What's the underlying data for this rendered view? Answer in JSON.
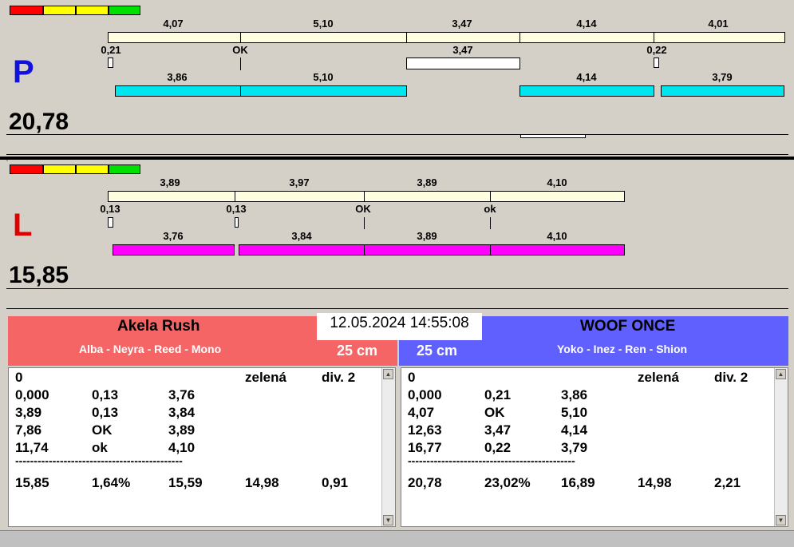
{
  "lanes": {
    "p": {
      "letter": "P",
      "letter_color": "#1010e0",
      "total": "20,78",
      "top_labels": [
        "4,07",
        "5,10",
        "3,47",
        "4,14",
        "4,01"
      ],
      "mid_labels": [
        "0,21",
        "OK",
        "3,47",
        "0,22"
      ],
      "bottom_labels": [
        "3,86",
        "5,10",
        "4,14",
        "3,79"
      ],
      "bar_color": "#00e5ee"
    },
    "l": {
      "letter": "L",
      "letter_color": "#e00000",
      "total": "15,85",
      "top_labels": [
        "3,89",
        "3,97",
        "3,89",
        "4,10"
      ],
      "mid_labels": [
        "0,13",
        "0,13",
        "OK",
        "ok"
      ],
      "bottom_labels": [
        "3,76",
        "3,84",
        "3,89",
        "4,10"
      ],
      "bar_color": "#ff00ff"
    }
  },
  "signal_colors": [
    "#ff0000",
    "#ffff00",
    "#ffff00",
    "#00e000"
  ],
  "datetime": "12.05.2024 14:55:08",
  "team_left": {
    "name": "Akela Rush",
    "dogs": "Alba - Neyra - Reed - Mono",
    "cm": "25 cm",
    "color": "#f56565"
  },
  "team_right": {
    "name": "WOOF ONCE",
    "dogs": "Yoko - Inez - Ren - Shion",
    "cm": "25 cm",
    "color": "#6060ff"
  },
  "panel_left": {
    "header": [
      "0",
      "",
      "",
      "zelená",
      "div. 2"
    ],
    "rows": [
      [
        "0,000",
        "0,13",
        "3,76"
      ],
      [
        "3,89",
        "0,13",
        "3,84"
      ],
      [
        "7,86",
        "OK",
        "3,89"
      ],
      [
        "11,74",
        "ok",
        "4,10"
      ]
    ],
    "separator": "---------------------------------------------",
    "summary": [
      "15,85",
      "1,64%",
      "15,59",
      "14,98",
      "0,91"
    ]
  },
  "panel_right": {
    "header": [
      "0",
      "",
      "",
      "zelená",
      "div. 2"
    ],
    "rows": [
      [
        "0,000",
        "0,21",
        "3,86"
      ],
      [
        "4,07",
        "OK",
        "5,10"
      ],
      [
        "12,63",
        "3,47",
        "4,14"
      ],
      [
        "16,77",
        "0,22",
        "3,79"
      ]
    ],
    "separator": "---------------------------------------------",
    "summary": [
      "20,78",
      "23,02%",
      "16,89",
      "14,98",
      "2,21"
    ]
  }
}
